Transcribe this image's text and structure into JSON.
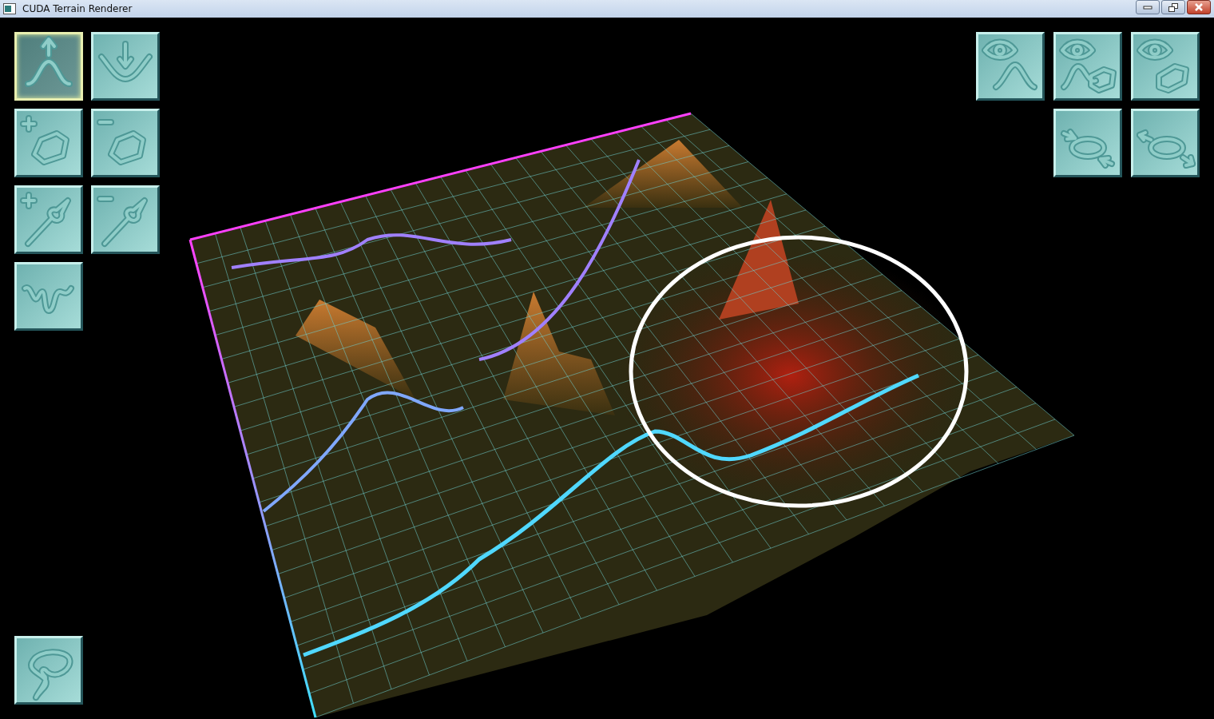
{
  "window": {
    "title": "CUDA Terrain Renderer"
  },
  "left_tools": [
    {
      "kind": "raise",
      "selected": true
    },
    {
      "kind": "lower",
      "selected": false
    },
    {
      "kind": "add-region",
      "selected": false
    },
    {
      "kind": "remove-region",
      "selected": false
    },
    {
      "kind": "add-brush",
      "selected": false
    },
    {
      "kind": "remove-brush",
      "selected": false
    },
    {
      "kind": "noise",
      "selected": false
    }
  ],
  "right_tools": [
    {
      "kind": "view-terrain",
      "selected": false
    },
    {
      "kind": "view-both",
      "selected": false
    },
    {
      "kind": "view-region",
      "selected": false
    },
    {
      "kind": "shrink",
      "selected": false
    },
    {
      "kind": "grow",
      "selected": false
    }
  ],
  "bottom_tool": {
    "kind": "path",
    "selected": false
  }
}
